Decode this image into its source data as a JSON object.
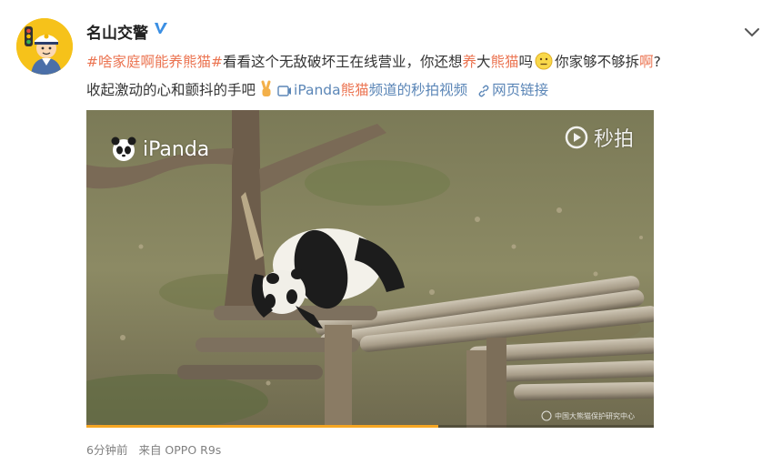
{
  "post": {
    "username": "名山交警",
    "verified_icon": "verified-v-icon",
    "line1": {
      "hashtag": "#啥家庭啊能养熊猫#",
      "t1": "看看这个无敌破坏王在线营业，你还想",
      "h1": "养",
      "t2": "大",
      "h2": "熊猫",
      "t3": "吗",
      "t4": "你家够不够拆",
      "h3": "啊",
      "t5": "?"
    },
    "line2": {
      "t1": "收起激动的心和颤抖的手吧",
      "video_prefix": "iPanda",
      "video_highlight": "熊猫",
      "video_suffix": "频道的秒拍视频",
      "web_link": "网页链接"
    },
    "media": {
      "watermark_left": "iPanda",
      "watermark_right": "秒拍",
      "watermark_bottom": "中国大熊猫保护研究中心",
      "progress": 0.62
    },
    "meta": {
      "time": "6分钟前",
      "source": "来自 OPPO R9s"
    },
    "colors": {
      "hashtag": "#eb7350",
      "link": "#5b86b7",
      "meta": "#808080"
    }
  }
}
